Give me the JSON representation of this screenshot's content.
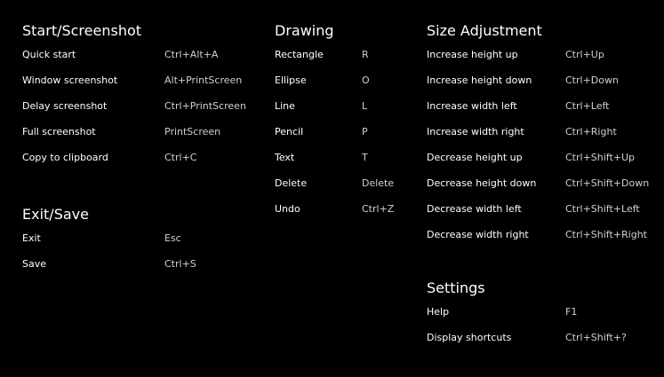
{
  "colors": {
    "background": "#000000",
    "title": "#ffffff",
    "action": "#ffffff",
    "shortcut": "#d0d0d0"
  },
  "start": {
    "title": "Start/Screenshot",
    "items": [
      {
        "label": "Quick start",
        "shortcut": "Ctrl+Alt+A"
      },
      {
        "label": "Window screenshot",
        "shortcut": "Alt+PrintScreen"
      },
      {
        "label": "Delay screenshot",
        "shortcut": "Ctrl+PrintScreen"
      },
      {
        "label": "Full screenshot",
        "shortcut": "PrintScreen"
      },
      {
        "label": "Copy to clipboard",
        "shortcut": "Ctrl+C"
      }
    ]
  },
  "exit_save": {
    "title": "Exit/Save",
    "items": [
      {
        "label": "Exit",
        "shortcut": "Esc"
      },
      {
        "label": "Save",
        "shortcut": "Ctrl+S"
      }
    ]
  },
  "drawing": {
    "title": "Drawing",
    "items": [
      {
        "label": "Rectangle",
        "shortcut": "R"
      },
      {
        "label": "Ellipse",
        "shortcut": "O"
      },
      {
        "label": "Line",
        "shortcut": "L"
      },
      {
        "label": "Pencil",
        "shortcut": "P"
      },
      {
        "label": "Text",
        "shortcut": "T"
      },
      {
        "label": "Delete",
        "shortcut": "Delete"
      },
      {
        "label": "Undo",
        "shortcut": "Ctrl+Z"
      }
    ]
  },
  "size": {
    "title": "Size Adjustment",
    "items": [
      {
        "label": "Increase height up",
        "shortcut": "Ctrl+Up"
      },
      {
        "label": "Increase height down",
        "shortcut": "Ctrl+Down"
      },
      {
        "label": "Increase width left",
        "shortcut": "Ctrl+Left"
      },
      {
        "label": "Increase width right",
        "shortcut": "Ctrl+Right"
      },
      {
        "label": "Decrease height up",
        "shortcut": "Ctrl+Shift+Up"
      },
      {
        "label": "Decrease height down",
        "shortcut": "Ctrl+Shift+Down"
      },
      {
        "label": "Decrease width left",
        "shortcut": "Ctrl+Shift+Left"
      },
      {
        "label": "Decrease width right",
        "shortcut": "Ctrl+Shift+Right"
      }
    ]
  },
  "settings": {
    "title": "Settings",
    "items": [
      {
        "label": "Help",
        "shortcut": "F1"
      },
      {
        "label": "Display shortcuts",
        "shortcut": "Ctrl+Shift+?"
      }
    ]
  }
}
